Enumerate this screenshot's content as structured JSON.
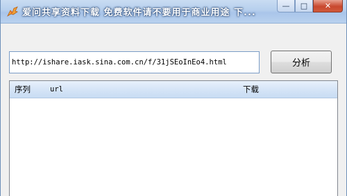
{
  "window": {
    "title": "爱问共享资料下载  免费软件请不要用于商业用途  下..."
  },
  "caption_buttons": {
    "minimize": "—",
    "maximize": "□",
    "close": "✕"
  },
  "form": {
    "url_value": "http://ishare.iask.sina.com.cn/f/31jSEoInEo4.html",
    "analyze_label": "分析"
  },
  "list": {
    "columns": [
      "序列",
      "url",
      "下载"
    ],
    "rows": []
  },
  "colors": {
    "title_gradient_top": "#c9dcf2",
    "header_gradient": "#d6e5f7",
    "close_button": "#c8482e"
  },
  "icons": {
    "app": "wing-icon"
  }
}
